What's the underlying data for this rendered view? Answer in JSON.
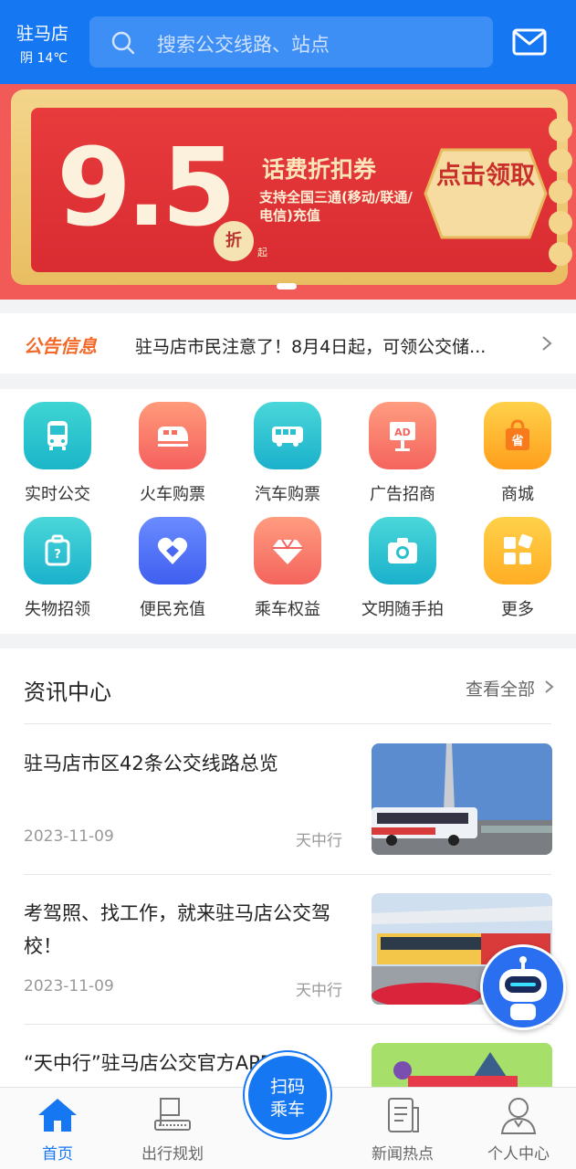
{
  "header": {
    "city": "驻马店",
    "weather": "阴 14℃",
    "search_placeholder": "搜索公交线路、站点"
  },
  "banner": {
    "discount": "9.5",
    "discount_unit": "折",
    "discount_suffix": "起",
    "title": "话费折扣券",
    "description": "支持全国三通(移动/联通/电信)充值",
    "cta": "点击领取",
    "colors": {
      "background": "#f15a56",
      "coupon_red": "#e83b3c",
      "gold": "#f3d58b"
    }
  },
  "notice": {
    "tag": "公告信息",
    "text": "驻马店市民注意了！8月4日起，可领公交储..."
  },
  "services": [
    {
      "label": "实时公交",
      "icon": "bus-icon"
    },
    {
      "label": "火车购票",
      "icon": "train-icon"
    },
    {
      "label": "汽车购票",
      "icon": "coach-icon"
    },
    {
      "label": "广告招商",
      "icon": "ad-board-icon"
    },
    {
      "label": "商城",
      "icon": "shopping-bag-icon"
    },
    {
      "label": "失物招领",
      "icon": "luggage-icon"
    },
    {
      "label": "便民充值",
      "icon": "heart-handshake-icon"
    },
    {
      "label": "乘车权益",
      "icon": "diamond-icon"
    },
    {
      "label": "文明随手拍",
      "icon": "camera-icon"
    },
    {
      "label": "更多",
      "icon": "grid-more-icon"
    }
  ],
  "news": {
    "title": "资讯中心",
    "more": "查看全部",
    "items": [
      {
        "headline": "驻马店市区42条公交线路总览",
        "date": "2023-11-09",
        "source": "天中行"
      },
      {
        "headline": "考驾照、找工作，就来驻马店公交驾校！",
        "date": "2023-11-09",
        "source": "天中行"
      },
      {
        "headline": "“天中行”驻马店公交官方APP上线",
        "date": "",
        "source": ""
      }
    ]
  },
  "tabbar": {
    "tabs": [
      {
        "label": "首页",
        "icon": "home-icon"
      },
      {
        "label": "出行规划",
        "icon": "route-plan-icon"
      },
      {
        "label": "新闻热点",
        "icon": "news-icon"
      },
      {
        "label": "个人中心",
        "icon": "user-icon"
      }
    ],
    "scan": "扫码乘车"
  },
  "colors": {
    "primary": "#1677f2",
    "notice_tag": "#f26a2a"
  }
}
